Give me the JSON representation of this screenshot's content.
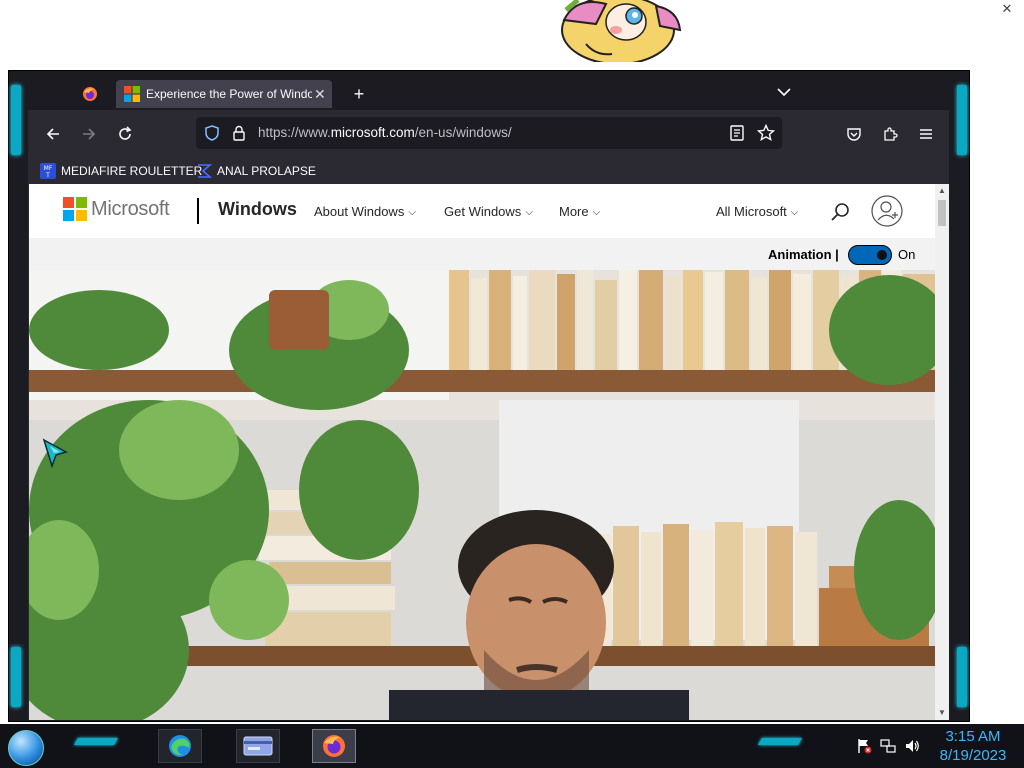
{
  "desktop": {
    "close_glyph": "✕"
  },
  "browser": {
    "tabs": [
      {
        "icon": "firefox-icon"
      },
      {
        "icon": "microsoft-favicon",
        "label": "Experience the Power of Windows",
        "close_glyph": "✕"
      }
    ],
    "new_tab_glyph": "+",
    "url": {
      "prefix": "https://www.",
      "domain": "microsoft.com",
      "path": "/en-us/windows/"
    },
    "bookmarks": [
      {
        "icon": "mediafire-icon",
        "label": "MEDIAFIRE ROULETTER"
      },
      {
        "icon": "sigma-icon",
        "label": "ANAL PROLAPSE"
      }
    ]
  },
  "page": {
    "brand": "Microsoft",
    "product": "Windows",
    "nav": [
      {
        "label": "About Windows"
      },
      {
        "label": "Get Windows"
      },
      {
        "label": "More"
      }
    ],
    "all_microsoft": "All Microsoft",
    "chevron": "⌵",
    "animation": {
      "label": "Animation |",
      "state": "On",
      "toggle_on": true
    },
    "logo_colors": [
      "#f25022",
      "#7fba00",
      "#00a4ef",
      "#ffb900"
    ]
  },
  "taskbar": {
    "clock_time": "3:15 AM",
    "clock_date": "8/19/2023",
    "apps": [
      "edge-icon",
      "card-icon",
      "firefox-icon"
    ]
  },
  "colors": {
    "accent_cyan": "#0aa8c2",
    "toggle_blue": "#0067b8",
    "clock_blue": "#39b7ff"
  }
}
